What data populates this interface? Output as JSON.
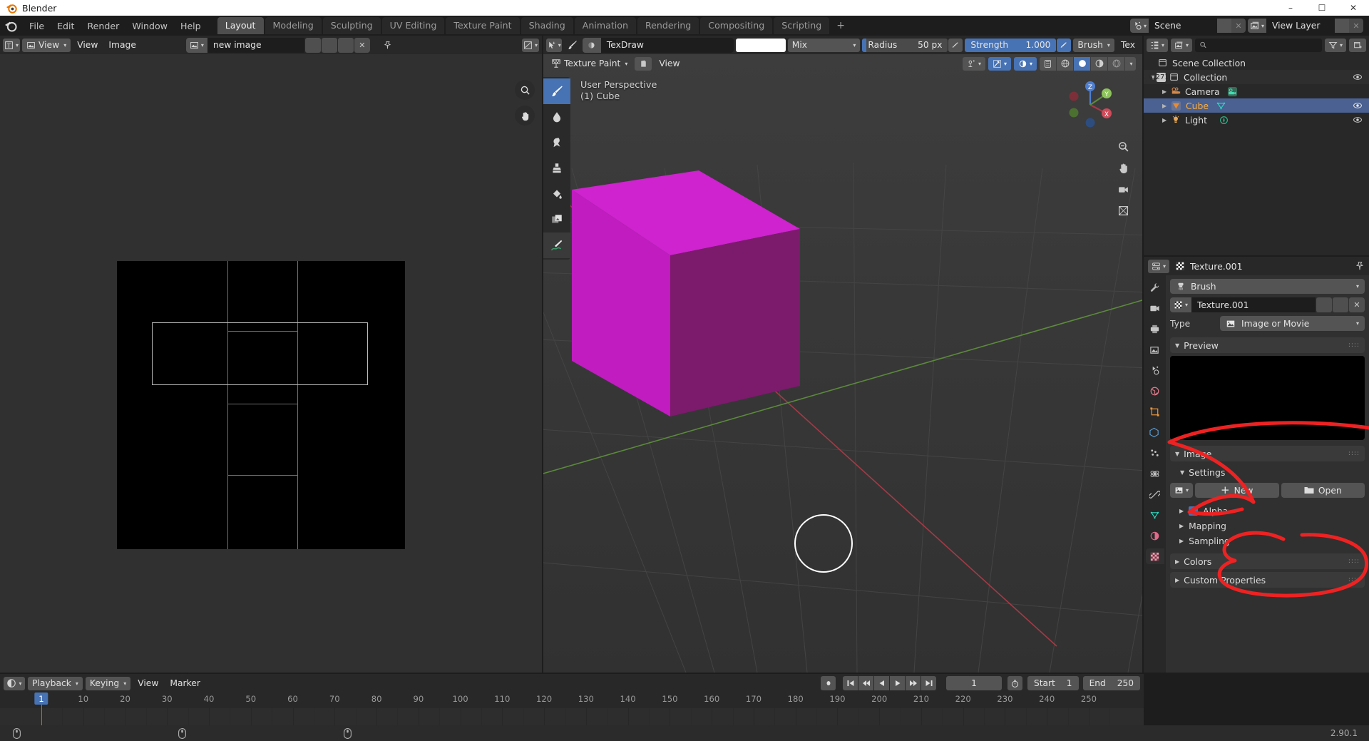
{
  "window": {
    "title": "Blender",
    "controls": {
      "minimize": "–",
      "maximize": "☐",
      "close": "✕"
    }
  },
  "topbar": {
    "menus": [
      "File",
      "Edit",
      "Render",
      "Window",
      "Help"
    ],
    "workspaces": [
      "Layout",
      "Modeling",
      "Sculpting",
      "UV Editing",
      "Texture Paint",
      "Shading",
      "Animation",
      "Rendering",
      "Compositing",
      "Scripting"
    ],
    "active_workspace": "Layout",
    "add_workspace": "+",
    "scene": {
      "label": "Scene",
      "icon": "scene-icon"
    },
    "view_layer": {
      "label": "View Layer",
      "icon": "view-layer-icon"
    }
  },
  "image_editor": {
    "editor_type_icon": "image-editor-icon",
    "mode": "View",
    "menus": [
      "View",
      "Image"
    ],
    "image_name": "new image",
    "buttons": [
      "fake-user-icon",
      "duplicate-icon",
      "open-icon",
      "unlink-icon",
      "pin-icon"
    ],
    "overlay_icon": "overlay-icon",
    "zoom_icon": "zoom-icon",
    "hand_icon": "hand-icon"
  },
  "viewport": {
    "tool_icon": "select-box-icon",
    "brush_icon": "brush-icon",
    "brush_name": "TexDraw",
    "color_swatch": "#ffffff",
    "blend_mode": "Mix",
    "radius": {
      "label": "Radius",
      "value": "50 px"
    },
    "strength": {
      "label": "Strength",
      "value": "1.000"
    },
    "brush_falloff": "Brush",
    "texture_label": "Tex",
    "mode": "Texture Paint",
    "view_menu": "View",
    "overlay_text_line1": "User Perspective",
    "overlay_text_line2": "(1) Cube",
    "tools": [
      "draw-tool-icon",
      "soften-tool-icon",
      "smear-tool-icon",
      "clone-tool-icon",
      "fill-tool-icon",
      "mask-tool-icon",
      "annotate-tool-icon"
    ],
    "active_tool_index": 0,
    "gizmo_axes": [
      "X",
      "Y",
      "Z"
    ],
    "nav_buttons": [
      "zoom-nav-icon",
      "pan-nav-icon",
      "camera-nav-icon",
      "ortho-nav-icon"
    ],
    "shading_modes": [
      "wireframe-shading-icon",
      "solid-shading-icon",
      "material-shading-icon",
      "rendered-shading-icon"
    ],
    "active_shading_index": 1,
    "cube_color_top": "#d420d4",
    "cube_color_left": "#c019c0",
    "cube_color_right": "#7a1a6a"
  },
  "outliner": {
    "display_mode_icon": "outliner-icon",
    "filter_icon": "filter-icon",
    "new_collection_icon": "new-collection-icon",
    "search_placeholder": "",
    "rows": [
      {
        "label": "Scene Collection",
        "icon": "collection-icon",
        "indent": 0,
        "selected": false,
        "eye": false,
        "disclosure": ""
      },
      {
        "label": "Collection",
        "icon": "collection-icon",
        "indent": 1,
        "selected": false,
        "eye": true,
        "disclosure": "▼",
        "checkbox": true
      },
      {
        "label": "Camera",
        "icon": "camera-icon",
        "indent": 2,
        "selected": false,
        "eye": true,
        "disclosure": "▶",
        "data_icon": "camera-data-icon"
      },
      {
        "label": "Cube",
        "icon": "mesh-icon",
        "indent": 2,
        "selected": true,
        "eye": true,
        "disclosure": "▶",
        "data_icon": "mesh-data-icon"
      },
      {
        "label": "Light",
        "icon": "light-icon",
        "indent": 2,
        "selected": false,
        "eye": true,
        "disclosure": "▶",
        "data_icon": "light-data-icon"
      }
    ]
  },
  "properties": {
    "editor_icon": "properties-icon",
    "breadcrumb": "Texture.001",
    "breadcrumb_icon": "texture-icon",
    "pin_icon": "pin-icon",
    "tabs": [
      "tool-tab-icon",
      "render-tab-icon",
      "output-tab-icon",
      "view-layer-tab-icon",
      "scene-tab-icon",
      "world-tab-icon",
      "object-tab-icon",
      "modifier-tab-icon",
      "particles-tab-icon",
      "physics-tab-icon",
      "constraints-tab-icon",
      "data-tab-icon",
      "material-tab-icon",
      "texture-tab-icon"
    ],
    "active_tab_index": 13,
    "context_selector": {
      "label": "Brush",
      "icon": "brush-icon"
    },
    "texture_id": {
      "name": "Texture.001",
      "icon": "texture-icon",
      "buttons": [
        "shield-icon",
        "duplicate-icon",
        "unlink-icon"
      ]
    },
    "type_row": {
      "label": "Type",
      "value": "Image or Movie",
      "icon": "image-icon"
    },
    "panels": [
      {
        "label": "Preview",
        "open": true
      },
      {
        "label": "Image",
        "open": true
      },
      {
        "label": "Settings",
        "open": true
      },
      {
        "label": "Alpha",
        "open": false,
        "checked": true
      },
      {
        "label": "Mapping",
        "open": false
      },
      {
        "label": "Sampling",
        "open": false
      },
      {
        "label": "Colors",
        "open": false
      },
      {
        "label": "Custom Properties",
        "open": false
      }
    ],
    "image_buttons": {
      "new": "New",
      "open": "Open",
      "new_icon": "plus-icon",
      "open_icon": "folder-icon",
      "browse_icon": "image-icon"
    }
  },
  "timeline": {
    "editor_icon": "timeline-icon",
    "menus": [
      "Playback",
      "Keying",
      "View",
      "Marker"
    ],
    "transport": [
      "record-icon",
      "jump-start-icon",
      "prev-keyframe-icon",
      "play-reverse-icon",
      "play-icon",
      "next-keyframe-icon",
      "jump-end-icon"
    ],
    "current_frame": "1",
    "start_label": "Start",
    "start_value": "1",
    "end_label": "End",
    "end_value": "250",
    "auto_key_icon": "stopwatch-icon",
    "ticks": [
      "1",
      "10",
      "20",
      "30",
      "40",
      "50",
      "60",
      "70",
      "80",
      "90",
      "100",
      "110",
      "120",
      "130",
      "140",
      "150",
      "160",
      "170",
      "180",
      "190",
      "200",
      "210",
      "220",
      "230",
      "240",
      "250"
    ],
    "playhead_frame": "1"
  },
  "statusbar": {
    "hints": [
      {
        "icon": "mouse-left-icon",
        "text": ""
      },
      {
        "icon": "mouse-middle-icon",
        "text": ""
      },
      {
        "icon": "mouse-right-icon",
        "text": ""
      }
    ],
    "version": "2.90.1"
  },
  "annotations": {
    "color": "#ee2222",
    "arrow_target": "Settings panel header",
    "circle_target": "Open button"
  }
}
